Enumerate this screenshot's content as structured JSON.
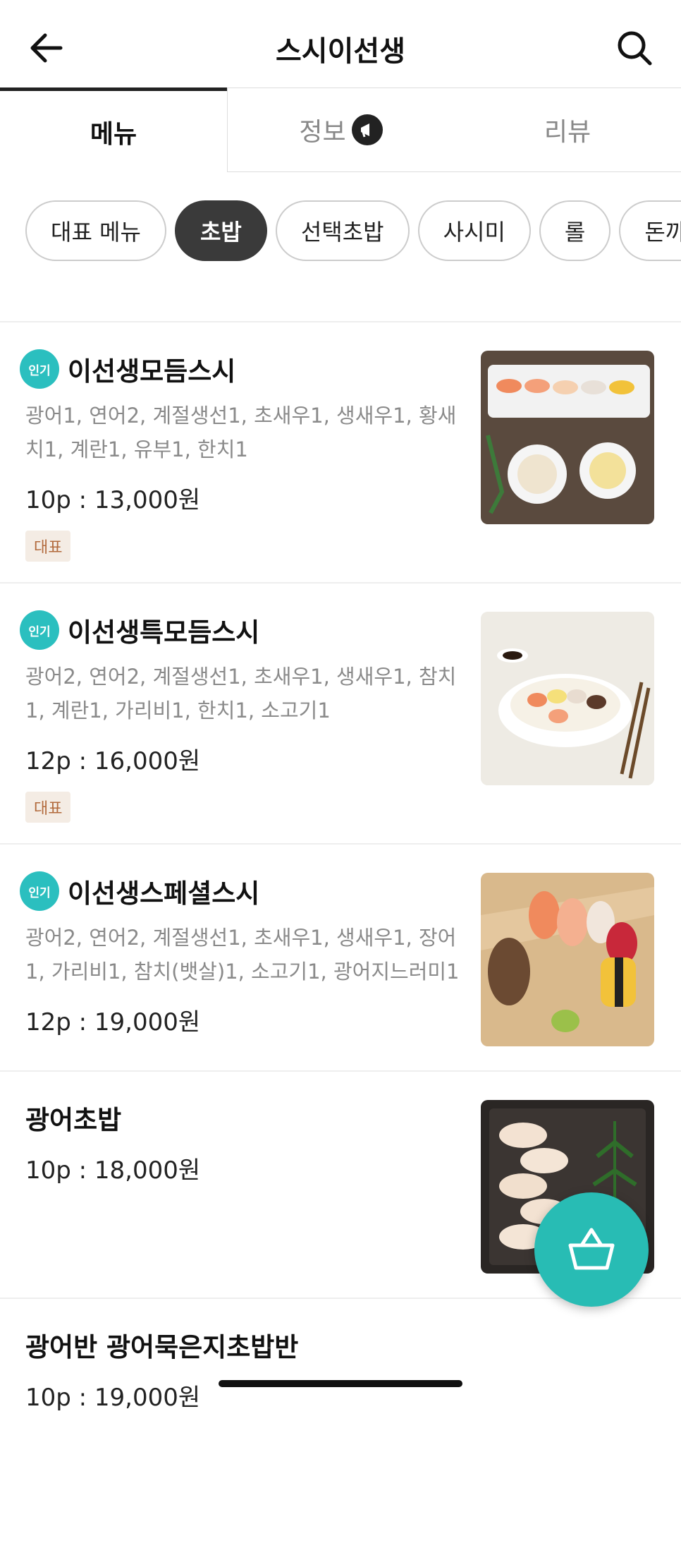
{
  "header": {
    "title": "스시이선생"
  },
  "tabs": [
    {
      "label": "메뉴"
    },
    {
      "label": "정보"
    },
    {
      "label": "리뷰"
    }
  ],
  "chips": [
    {
      "label": "대표 메뉴"
    },
    {
      "label": "초밥"
    },
    {
      "label": "선택초밥"
    },
    {
      "label": "사시미"
    },
    {
      "label": "롤"
    },
    {
      "label": "돈까"
    }
  ],
  "popular_badge": "인기",
  "menu": [
    {
      "name": "이선생모듬스시",
      "desc": "광어1, 연어2, 계절생선1, 초새우1, 생새우1, 황새치1, 계란1, 유부1, 한치1",
      "price": "10p : 13,000원",
      "tag": "대표"
    },
    {
      "name": "이선생특모듬스시",
      "desc": "광어2, 연어2, 계절생선1, 초새우1, 생새우1, 참치1, 계란1, 가리비1, 한치1, 소고기1",
      "price": "12p : 16,000원",
      "tag": "대표"
    },
    {
      "name": "이선생스페셜스시",
      "desc": "광어2, 연어2, 계절생선1, 초새우1, 생새우1, 장어1, 가리비1, 참치(뱃살)1, 소고기1, 광어지느러미1",
      "price": "12p : 19,000원"
    },
    {
      "name": "광어초밥",
      "price": "10p : 18,000원"
    },
    {
      "name": "광어반 광어묵은지초밥반",
      "price": "10p : 19,000원"
    }
  ],
  "colors": {
    "accent": "#28bcb4",
    "tag_bg": "#f4ece4",
    "tag_text": "#b26a3c"
  }
}
